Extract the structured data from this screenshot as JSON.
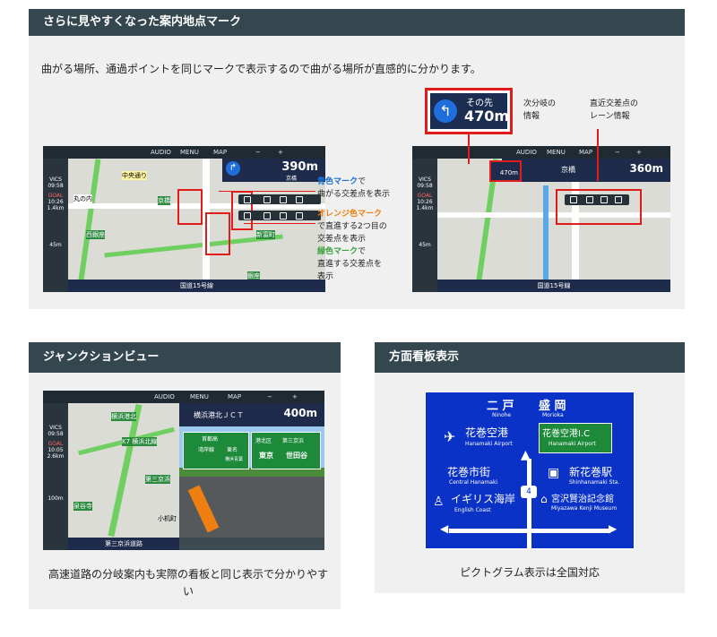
{
  "section1": {
    "title": "さらに見やすくなった案内地点マーク",
    "description": "曲がる場所、通過ポイントを同じマークで表示するので曲がる場所が直感的に分かります。",
    "nav_left": {
      "menu_labels": [
        "AUDIO",
        "MENU",
        "MAP",
        "−",
        "+"
      ],
      "distance": "390m",
      "place": "京橋",
      "road": "国道15号線",
      "left_info": [
        "VICS",
        "09:58",
        "GOAL",
        "10:26",
        "1.4km",
        "45m"
      ],
      "map_labels": [
        "中央通り",
        "丸の内",
        "京橋",
        "西銀座",
        "新富町",
        "銀座"
      ]
    },
    "callout": {
      "blue_label": "青色マーク",
      "blue_text": [
        "で",
        "曲がる交差点を表示"
      ],
      "orange_label": "オレンジ色マーク",
      "orange_text": [
        "で直進する2つ目の",
        "交差点を表示"
      ],
      "green_label": "緑色マーク",
      "green_text": [
        "で",
        "直進する交差点を",
        "表示"
      ]
    },
    "nav_right": {
      "menu_labels": [
        "AUDIO",
        "MENU",
        "MAP",
        "−",
        "+"
      ],
      "distance": "360m",
      "place": "京橋",
      "road": "国道15号線",
      "small_distance": "470m",
      "left_info": [
        "VICS",
        "09:58",
        "GOAL",
        "10:26",
        "1.4km",
        "45m"
      ]
    },
    "zoom": {
      "top": "その先",
      "distance": "470m"
    },
    "label_next": [
      "次分岐の",
      "情報"
    ],
    "label_lane": [
      "直近交差点の",
      "レーン情報"
    ]
  },
  "section2": {
    "title": "ジャンクションビュー",
    "caption": "高速道路の分岐案内も実際の看板と同じ表示で分かりやすい",
    "nav": {
      "menu_labels": [
        "AUDIO",
        "MENU",
        "MAP",
        "−",
        "+"
      ],
      "jct_name": "横浜港北ＪＣＴ",
      "distance": "400m",
      "road": "第三京浜道路",
      "map_labels": [
        "横浜港北",
        "K7 横浜北線",
        "泉谷寺",
        "第三京浜",
        "小机町"
      ],
      "left_info": [
        "VICS",
        "09:58",
        "GOAL",
        "10:05",
        "2.6km",
        "100m"
      ],
      "signs": [
        "首都高",
        "湾岸線",
        "東名",
        "横浜青葉",
        "港北区",
        "東京",
        "世田谷",
        "第三京浜"
      ]
    }
  },
  "section3": {
    "title": "方面看板表示",
    "caption": "ピクトグラム表示は全国対応",
    "sign": {
      "top_jp": [
        "二 戸",
        "盛 岡"
      ],
      "top_en": [
        "Ninohe",
        "Morioka"
      ],
      "airport_jp": "花巻空港",
      "airport_en": "Hanamaki Airport",
      "ic_jp": "花巻空港I.C",
      "ic_en": "Hanamaki Airport",
      "city_jp": "花巻市街",
      "city_en": "Central Hanamaki",
      "station_jp": "新花巻駅",
      "station_en": "Shinhanamaki Sta.",
      "coast_jp": "イギリス海岸",
      "coast_en": "English Coast",
      "museum_jp": "宮沢賢治記念館",
      "museum_en": "Miyazawa Kenji Museum",
      "route": "4"
    },
    "colors": {
      "sign_blue": "#0a32c7",
      "ic_green": "#1d8a3a"
    }
  }
}
